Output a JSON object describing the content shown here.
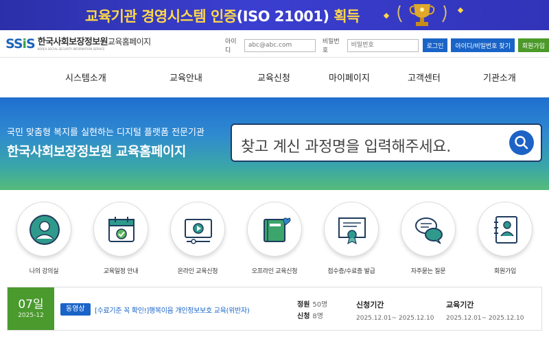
{
  "banner": {
    "text_highlight": "교육기관 경영시스템 인증",
    "text_iso": "(ISO 21001)",
    "text_end": "획득",
    "accent_color": "#ffd84a"
  },
  "header": {
    "logo_mark": "SSiS",
    "logo_name": "한국사회보장정보원",
    "logo_sub": "교육홈페이지",
    "logo_english": "KOREA SOCIAL SECURITY INFORMATION SERVICE",
    "id_label": "아이디",
    "id_placeholder": "abc@abc.com",
    "pw_label": "비밀번호",
    "pw_placeholder": "비밀번호",
    "login_button": "로그인",
    "find_button": "아이디/비밀번호 찾기",
    "join_button": "회원가입"
  },
  "nav": {
    "items": [
      "시스템소개",
      "교육안내",
      "교육신청",
      "마이페이지",
      "고객센터",
      "기관소개"
    ]
  },
  "hero": {
    "subtitle": "국민 맞춤형 복지를 실현하는 디지털 플랫폼 전문기관",
    "title": "한국사회보장정보원 교육홈페이지",
    "search_placeholder": "찾고 계신 과정명을 입력해주세요."
  },
  "quick_menu": [
    {
      "label": "나의 강의실",
      "icon": "user-circle-icon"
    },
    {
      "label": "교육일정 안내",
      "icon": "calendar-check-icon"
    },
    {
      "label": "온라인 교육신청",
      "icon": "video-play-icon"
    },
    {
      "label": "오프라인 교육신청",
      "icon": "book-heart-icon"
    },
    {
      "label": "접수증/수료증 발급",
      "icon": "certificate-icon"
    },
    {
      "label": "자주묻는 질문",
      "icon": "chat-bubbles-icon"
    },
    {
      "label": "회원가입",
      "icon": "address-book-icon"
    }
  ],
  "course": {
    "day": "07일",
    "year_month": "2025-12",
    "tag": "동영상",
    "title": "[수료기준 꼭 확인!]행복이음 개인정보보호 교육(위반자)",
    "capacity_label": "정원",
    "capacity_value": "50명",
    "applied_label": "신청",
    "applied_value": "8명",
    "apply_period_label": "신청기간",
    "apply_period_value": "2025.12.01~ 2025.12.10",
    "edu_period_label": "교육기간",
    "edu_period_value": "2025.12.01~ 2025.12.10"
  },
  "colors": {
    "primary_blue": "#1a64c8",
    "green": "#4a9a2e"
  }
}
